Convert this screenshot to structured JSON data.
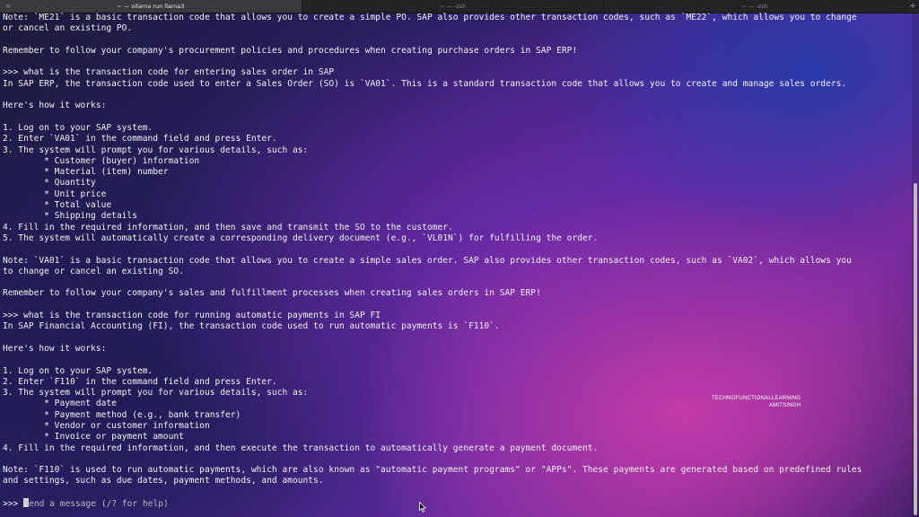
{
  "tabs": [
    {
      "title": "~ — ollama run llama3",
      "active": true,
      "close_glyph": "×"
    },
    {
      "title": "~ — -zsh",
      "active": false,
      "close_glyph": ""
    },
    {
      "title": "~ — -zsh",
      "active": false,
      "close_glyph": ""
    }
  ],
  "new_tab_glyph": "+",
  "terminal": {
    "lines": [
      "Note: `ME21` is a basic transaction code that allows you to create a simple PO. SAP also provides other transaction codes, such as `ME22`, which allows you to change",
      "or cancel an existing PO.",
      "",
      "Remember to follow your company's procurement policies and procedures when creating purchase orders in SAP ERP!",
      "",
      ">>> what is the transaction code for entering sales order in SAP",
      "In SAP ERP, the transaction code used to enter a Sales Order (SO) is `VA01`. This is a standard transaction code that allows you to create and manage sales orders.",
      "",
      "Here's how it works:",
      "",
      "1. Log on to your SAP system.",
      "2. Enter `VA01` in the command field and press Enter.",
      "3. The system will prompt you for various details, such as:",
      "        * Customer (buyer) information",
      "        * Material (item) number",
      "        * Quantity",
      "        * Unit price",
      "        * Total value",
      "        * Shipping details",
      "4. Fill in the required information, and then save and transmit the SO to the customer.",
      "5. The system will automatically create a corresponding delivery document (e.g., `VL01N`) for fulfilling the order.",
      "",
      "Note: `VA01` is a basic transaction code that allows you to create a simple sales order. SAP also provides other transaction codes, such as `VA02`, which allows you",
      "to change or cancel an existing SO.",
      "",
      "Remember to follow your company's sales and fulfillment processes when creating sales orders in SAP ERP!",
      "",
      ">>> what is the transaction code for running automatic payments in SAP FI",
      "In SAP Financial Accounting (FI), the transaction code used to run automatic payments is `F110`.",
      "",
      "Here's how it works:",
      "",
      "1. Log on to your SAP system.",
      "2. Enter `F110` in the command field and press Enter.",
      "3. The system will prompt you for various details, such as:",
      "        * Payment date",
      "        * Payment method (e.g., bank transfer)",
      "        * Vendor or customer information",
      "        * Invoice or payment amount",
      "4. Fill in the required information, and then execute the transaction to automatically generate a payment document.",
      "",
      "Note: `F110` is used to run automatic payments, which are also known as \"automatic payment programs\" or \"APPs\". These payments are generated based on predefined rules",
      "and settings, such as due dates, payment methods, and amounts.",
      ""
    ],
    "input_prompt": ">>> ",
    "input_placeholder": "Send a message (/? for help)"
  },
  "watermark": {
    "line1": "TECHNOFUNCTIONALLEARNING",
    "line2": "AMITSINGH"
  }
}
